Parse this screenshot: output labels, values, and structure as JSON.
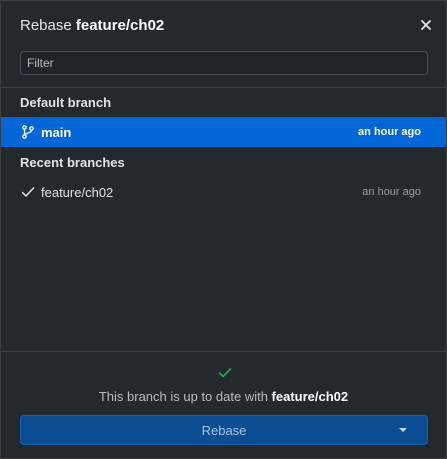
{
  "dialog": {
    "title_prefix": "Rebase ",
    "title_branch": "feature/ch02"
  },
  "filter": {
    "placeholder": "Filter",
    "value": ""
  },
  "sections": {
    "default": {
      "header": "Default branch",
      "branch": {
        "name": "main",
        "time": "an hour ago",
        "icon": "git-branch-icon",
        "selected": true
      }
    },
    "recent": {
      "header": "Recent branches",
      "branch": {
        "name": "feature/ch02",
        "time": "an hour ago",
        "icon": "check-icon",
        "selected": false
      }
    }
  },
  "footer": {
    "status_icon": "check-icon",
    "status_prefix": "This branch is up to date with ",
    "status_branch": "feature/ch02",
    "button_label": "Rebase"
  },
  "colors": {
    "background": "#24292e",
    "selected_row": "#0366d6",
    "button": "#0b4d93",
    "success": "#28a745"
  }
}
